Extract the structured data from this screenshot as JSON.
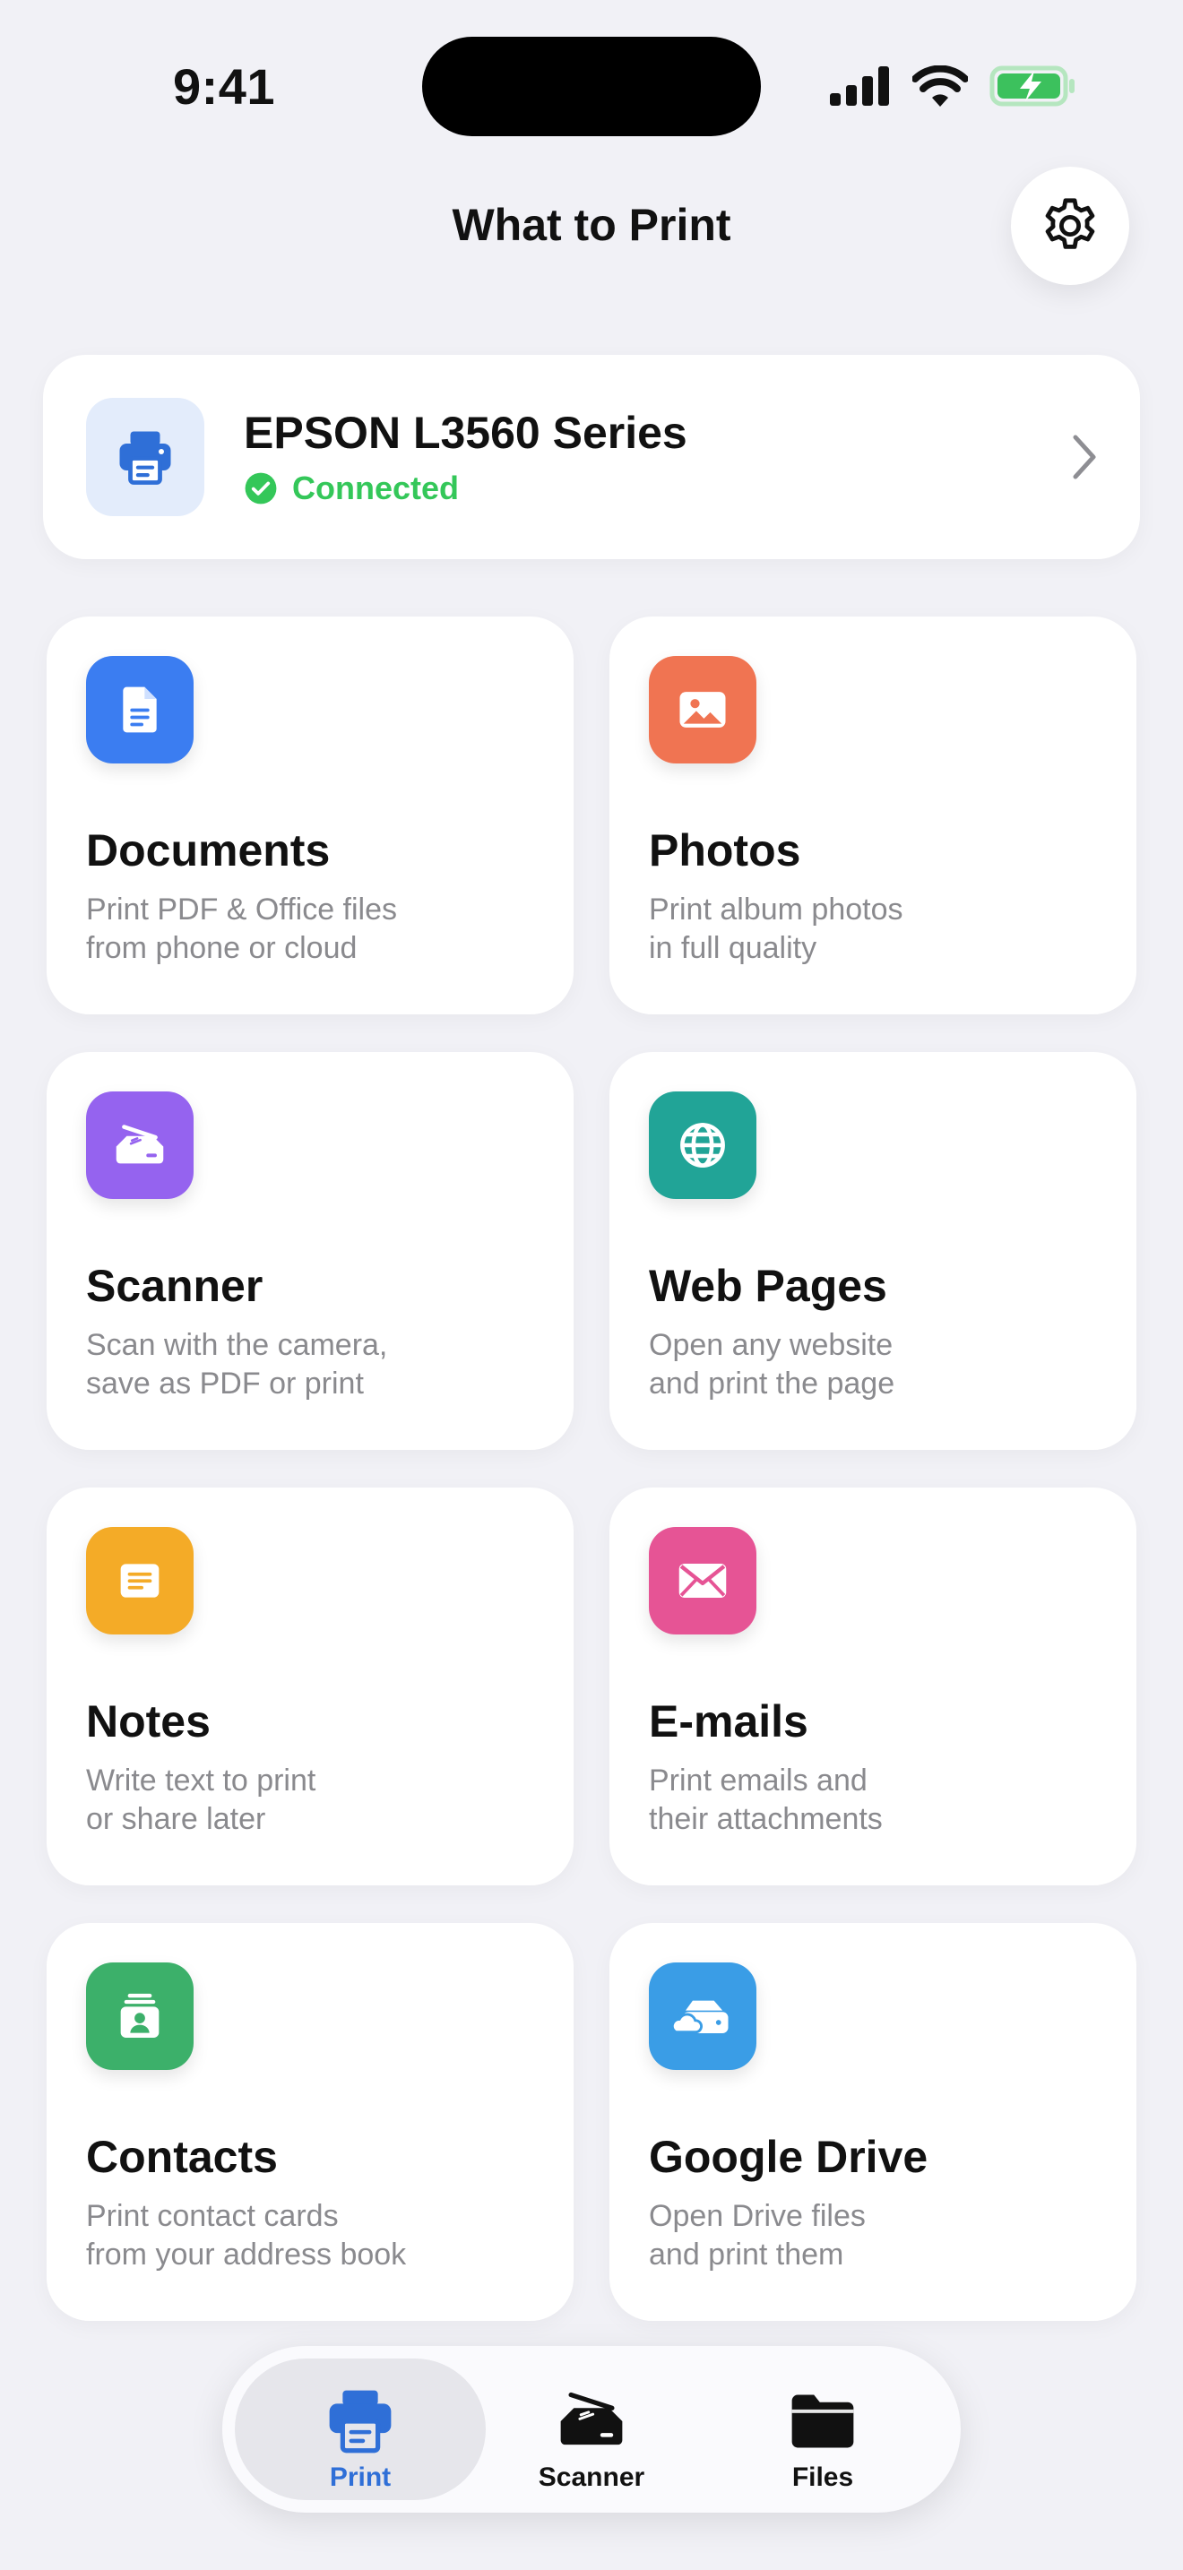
{
  "status_bar": {
    "time": "9:41"
  },
  "header": {
    "title": "What to Print"
  },
  "printer": {
    "name": "EPSON L3560 Series",
    "status": "Connected"
  },
  "colors": {
    "accent": "#2f6fd7",
    "connected": "#34c759",
    "documents": "#3b7df1",
    "photos": "#f07452",
    "scanner": "#9563ef",
    "web_pages": "#21a497",
    "notes": "#f4ab27",
    "emails": "#e65495",
    "contacts": "#3cb06a",
    "google_drive": "#3a9de6"
  },
  "features": [
    {
      "id": "documents",
      "icon": "document-icon",
      "title": "Documents",
      "desc_line1": "Print PDF & Office files",
      "desc_line2": "from phone or cloud"
    },
    {
      "id": "photos",
      "icon": "photo-icon",
      "title": "Photos",
      "desc_line1": "Print album photos",
      "desc_line2": "in full quality"
    },
    {
      "id": "scanner",
      "icon": "scanner-icon",
      "title": "Scanner",
      "desc_line1": "Scan with the camera,",
      "desc_line2": "save as PDF or print"
    },
    {
      "id": "web_pages",
      "icon": "globe-icon",
      "title": "Web Pages",
      "desc_line1": "Open any website",
      "desc_line2": "and print the page"
    },
    {
      "id": "notes",
      "icon": "note-icon",
      "title": "Notes",
      "desc_line1": "Write text to print",
      "desc_line2": "or share later"
    },
    {
      "id": "emails",
      "icon": "envelope-icon",
      "title": "E-mails",
      "desc_line1": "Print emails and",
      "desc_line2": "their attachments"
    },
    {
      "id": "contacts",
      "icon": "contact-card-icon",
      "title": "Contacts",
      "desc_line1": "Print contact cards",
      "desc_line2": "from your address book"
    },
    {
      "id": "google_drive",
      "icon": "cloud-drive-icon",
      "title": "Google Drive",
      "desc_line1": "Open Drive files",
      "desc_line2": "and print them"
    }
  ],
  "tabs": [
    {
      "label": "Print",
      "icon": "printer-icon",
      "active": true
    },
    {
      "label": "Scanner",
      "icon": "scanner-icon",
      "active": false
    },
    {
      "label": "Files",
      "icon": "folder-icon",
      "active": false
    }
  ]
}
